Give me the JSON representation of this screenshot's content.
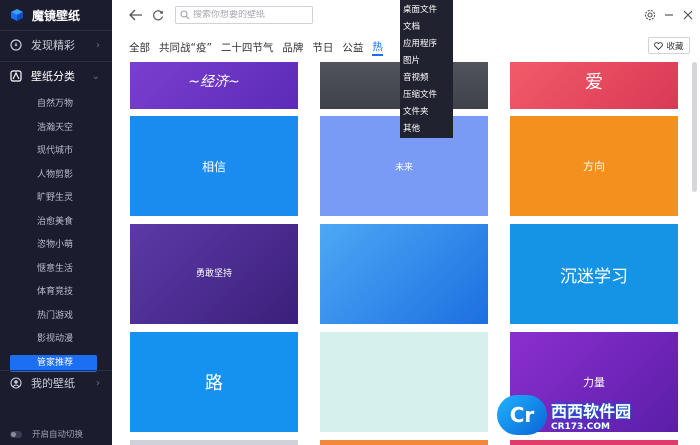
{
  "app": {
    "name": "魔镜壁纸"
  },
  "sidebar": {
    "discover": "发现精彩",
    "categories_label": "壁纸分类",
    "sub_items": [
      "自然万物",
      "浩瀚天空",
      "现代城市",
      "人物剪影",
      "旷野生灵",
      "治愈美食",
      "恣物小萌",
      "惬意生活",
      "体育竞技",
      "热门游戏",
      "影视动漫",
      "管家推荐"
    ],
    "my_wallpaper": "我的壁纸",
    "autostart": "开启自动切换"
  },
  "header": {
    "search_placeholder": "搜索你想要的壁纸"
  },
  "categories": [
    "全部",
    "共同战“疫”",
    "二十四节气",
    "品牌",
    "节日",
    "公益",
    "热"
  ],
  "favorites_label": "收藏",
  "dropdown": [
    "桌面文件",
    "文档",
    "应用程序",
    "图片",
    "音视频",
    "压缩文件",
    "文件夹",
    "其他"
  ],
  "tiles": [
    {
      "art": "~经济~",
      "bg": "linear-gradient(135deg,#7d3fd0,#5b2bb8)"
    },
    {
      "art": "",
      "bg": "linear-gradient(180deg,#55585f,#3f4249)"
    },
    {
      "art": "爱",
      "bg": "linear-gradient(135deg,#f45c6a,#d83a55)"
    },
    {
      "art": "相信",
      "bg": "#1a8cf0"
    },
    {
      "art": "未来",
      "bg": "#7a9bf5"
    },
    {
      "art": "方向",
      "bg": "#f3901e"
    },
    {
      "art": "勇敢坚持",
      "bg": "linear-gradient(135deg,#5d3aa8,#3b1f7a)"
    },
    {
      "art": "",
      "bg": "linear-gradient(135deg,#4ea8f5,#1d6fe0)"
    },
    {
      "art": "沉迷学习",
      "bg": "#1594e6"
    },
    {
      "art": "路",
      "bg": "#1592f0"
    },
    {
      "art": "",
      "bg": "#d6f0ee"
    },
    {
      "art": "力量",
      "bg": "linear-gradient(135deg,#8b2fcf,#5b1ea8)"
    }
  ],
  "watermark": {
    "logo": "Cr",
    "title": "西西软件园",
    "url": "CR173.COM"
  },
  "colors": {
    "accent": "#1c6ef2",
    "sidebar_bg": "#1b1d2e"
  }
}
